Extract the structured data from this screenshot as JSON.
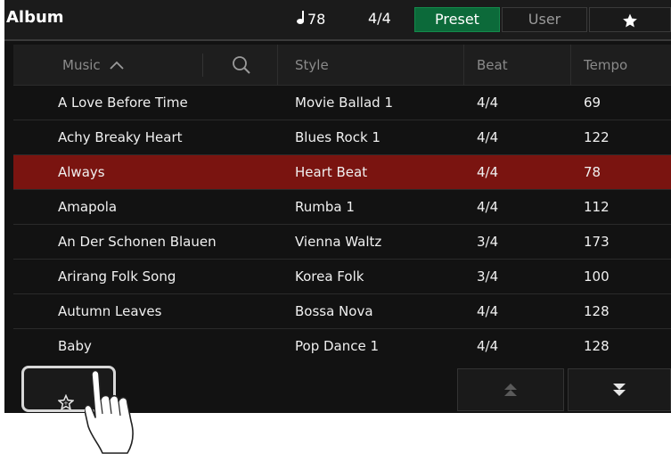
{
  "header": {
    "title": "Album",
    "tempo": "78",
    "beat": "4/4",
    "tabs": {
      "preset": "Preset",
      "user": "User"
    }
  },
  "table": {
    "columns": {
      "music": "Music",
      "style": "Style",
      "beat": "Beat",
      "tempo": "Tempo"
    },
    "rows": [
      {
        "music": "A Love Before Time",
        "style": "Movie Ballad 1",
        "beat": "4/4",
        "tempo": "69"
      },
      {
        "music": "Achy Breaky Heart",
        "style": "Blues Rock 1",
        "beat": "4/4",
        "tempo": "122"
      },
      {
        "music": "Always",
        "style": "Heart Beat",
        "beat": "4/4",
        "tempo": "78"
      },
      {
        "music": "Amapola",
        "style": "Rumba 1",
        "beat": "4/4",
        "tempo": "112"
      },
      {
        "music": "An Der Schonen Blauen",
        "style": "Vienna Waltz",
        "beat": "3/4",
        "tempo": "173"
      },
      {
        "music": "Arirang Folk Song",
        "style": "Korea Folk",
        "beat": "3/4",
        "tempo": "100"
      },
      {
        "music": "Autumn Leaves",
        "style": "Bossa Nova",
        "beat": "4/4",
        "tempo": "128"
      },
      {
        "music": "Baby",
        "style": "Pop Dance 1",
        "beat": "4/4",
        "tempo": "128"
      }
    ],
    "selected_row": "Always"
  },
  "colors": {
    "accent_tab": "#0c6a3a",
    "selected_row": "#7a1410",
    "background": "#121212"
  },
  "icons": [
    "note-icon",
    "star-icon",
    "search-icon",
    "sort-up-icon",
    "favorite-star-icon",
    "page-up-icon",
    "page-down-icon",
    "pointing-hand-icon"
  ]
}
